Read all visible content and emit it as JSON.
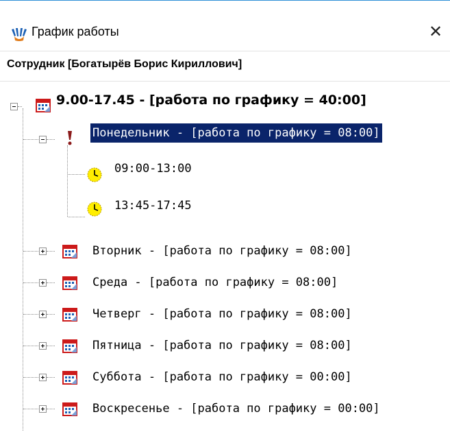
{
  "window": {
    "title": "График работы",
    "close_glyph": "✕",
    "app_icon": "hands-icon"
  },
  "employee_header": "Сотрудник [Богатырёв Борис Кириллович]",
  "tree": {
    "root": {
      "label": "9.00-17.45 - [работа по графику = 40:00]",
      "icon": "calendar-icon",
      "expanded": true
    },
    "monday": {
      "label": "Понедельник - [работа по графику = 08:00]",
      "icon": "exclamation-icon",
      "expanded": true,
      "selected": true,
      "intervals": [
        {
          "label": "09:00-13:00",
          "icon": "clock-icon"
        },
        {
          "label": "13:45-17:45",
          "icon": "clock-icon"
        }
      ]
    },
    "days": [
      {
        "label": "Вторник - [работа по графику = 08:00]",
        "icon": "calendar-icon"
      },
      {
        "label": "Среда - [работа по графику = 08:00]",
        "icon": "calendar-icon"
      },
      {
        "label": "Четверг - [работа по графику = 08:00]",
        "icon": "calendar-icon"
      },
      {
        "label": "Пятница - [работа по графику = 08:00]",
        "icon": "calendar-icon"
      },
      {
        "label": "Суббота - [работа по графику = 00:00]",
        "icon": "calendar-icon"
      },
      {
        "label": "Воскресенье - [работа по графику = 00:00]",
        "icon": "calendar-icon"
      }
    ]
  },
  "colors": {
    "selection_bg": "#0a246a",
    "selection_fg": "#ffffff",
    "calendar_red": "#cc1a1a",
    "clock_yellow": "#ffee00",
    "window_border": "#2d8fd6"
  }
}
